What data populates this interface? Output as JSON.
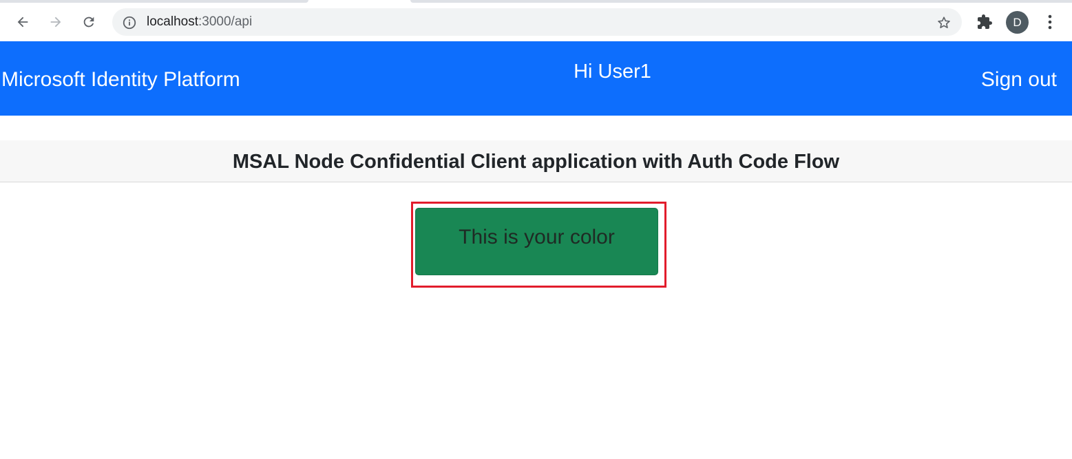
{
  "browser": {
    "url_host": "localhost",
    "url_path": ":3000/api",
    "avatar_letter": "D"
  },
  "navbar": {
    "brand": "Microsoft Identity Platform",
    "greeting": "Hi User1",
    "signout": "Sign out",
    "color": "#0d6efd"
  },
  "card": {
    "title": "MSAL Node Confidential Client application with Auth Code Flow"
  },
  "result": {
    "text": "This is your color",
    "color": "#198754",
    "highlight_color": "#e21c2c"
  }
}
